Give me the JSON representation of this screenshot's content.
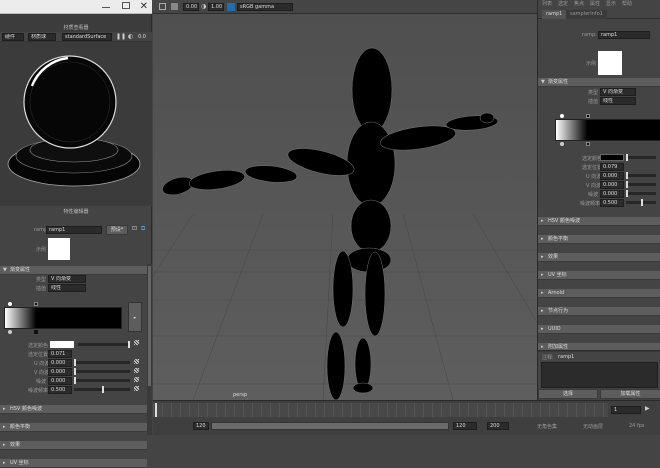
{
  "hypershade": {
    "title": "材质查看器",
    "toolbar": {
      "renderer": "硬件",
      "shape": "材质球",
      "material": "standardSurface",
      "exposure": "0.0"
    },
    "editor_title": "特性编辑器"
  },
  "viewport": {
    "values": [
      "0.00",
      "1.00",
      "sRGB gamma"
    ],
    "camera_label": "persp"
  },
  "left_attr": {
    "node_label": "ramp:",
    "node_name": "ramp1",
    "preset_button": "预设*",
    "sample_label": "示例",
    "section_label": "渐变属性",
    "type_label": "类型",
    "type_value": "V 向渐变",
    "interp_label": "插值",
    "interp_value": "线性",
    "rows": [
      {
        "label": "选定颜色",
        "value": ""
      },
      {
        "label": "选定位置",
        "value": "0.071"
      },
      {
        "label": "U 向波",
        "value": "0.000"
      },
      {
        "label": "V 向波",
        "value": "0.000"
      },
      {
        "label": "噪波",
        "value": "0.000"
      },
      {
        "label": "噪波频率",
        "value": "0.500"
      }
    ],
    "collapsed": [
      "HSV 颜色噪波",
      "颜色平衡",
      "效果",
      "UV 坐标"
    ]
  },
  "right_attr": {
    "menu": [
      "列表",
      "选定",
      "焦点",
      "属性",
      "显示",
      "帮助"
    ],
    "tabs": [
      "ramp1",
      "samplerInfo1"
    ],
    "node_label": "ramp:",
    "node_name": "ramp1",
    "sample_label": "示例",
    "section_label": "渐变属性",
    "type_label": "类型",
    "type_value": "V 向渐变",
    "interp_label": "插值",
    "interp_value": "线性",
    "rows": [
      {
        "label": "选定颜色",
        "value": ""
      },
      {
        "label": "选定位置",
        "value": "0.079"
      },
      {
        "label": "U 向波",
        "value": "0.000"
      },
      {
        "label": "V 向波",
        "value": "0.000"
      },
      {
        "label": "噪波",
        "value": "0.000"
      },
      {
        "label": "噪波频率",
        "value": "0.500"
      }
    ],
    "collapsed": [
      "HSV 颜色噪波",
      "颜色平衡",
      "效果",
      "UV 坐标",
      "Arnold",
      "节点行为",
      "UUID",
      "附加属性"
    ],
    "notes_label": "注释:",
    "notes_value": "ramp1",
    "select_button": "选择",
    "load_button": "加载属性"
  },
  "timeline": {
    "start": "1",
    "range_start": "120",
    "range_end": "120",
    "range_end2": "200",
    "no_character": "无角色集",
    "no_anim_layer": "无动画层",
    "fps": "24 fps"
  },
  "colors": {
    "panel": "#444444",
    "viewport": "#5a5a5a",
    "accent": "#1f6fb0"
  }
}
